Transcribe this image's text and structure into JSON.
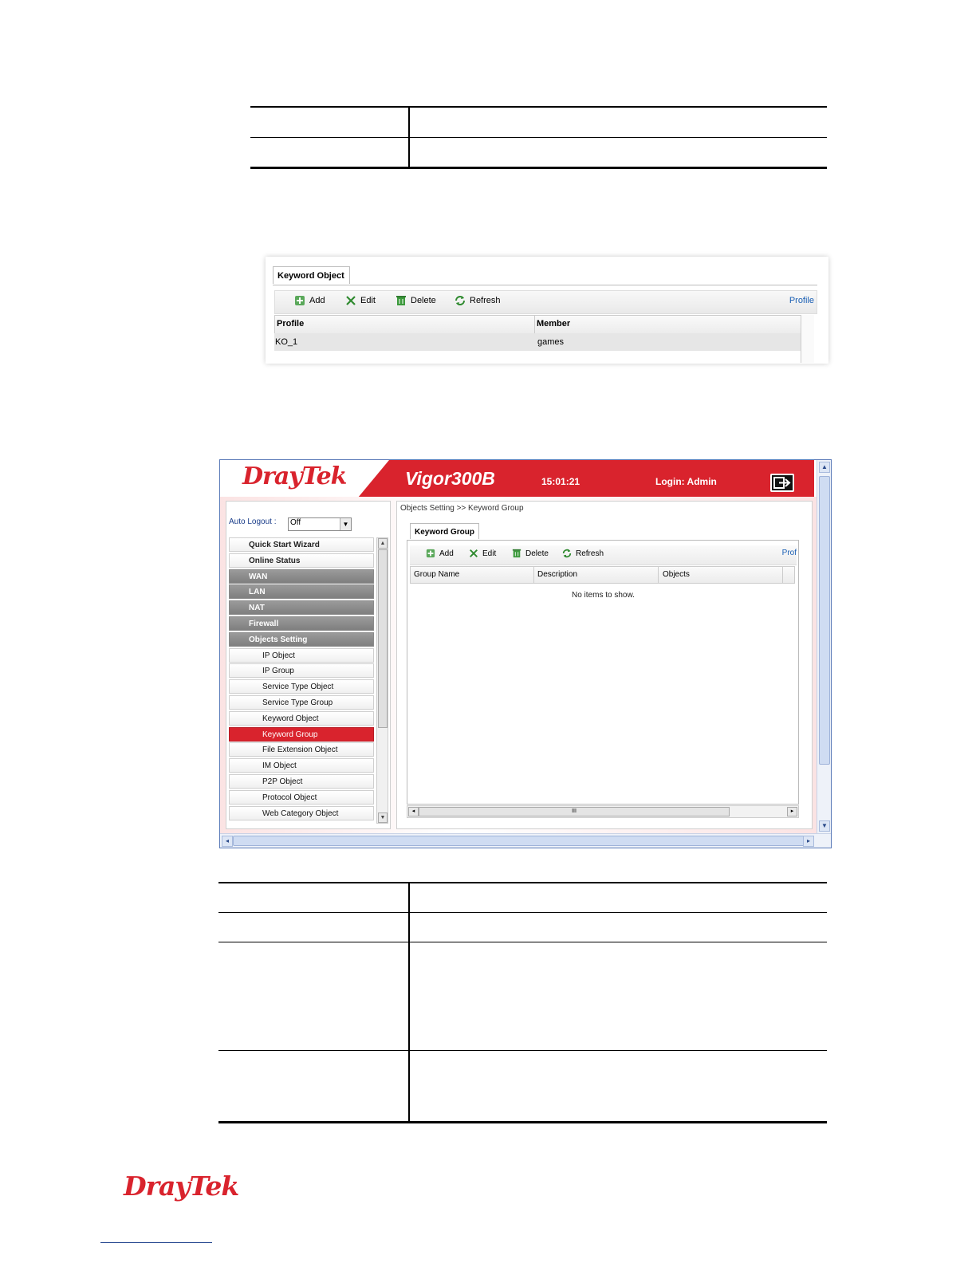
{
  "keyword_object": {
    "tab": "Keyword Object",
    "toolbar": {
      "add": "Add",
      "edit": "Edit",
      "delete": "Delete",
      "refresh": "Refresh",
      "profile_link": "Profile"
    },
    "columns": [
      "Profile",
      "Member"
    ],
    "rows": [
      {
        "profile": "KO_1",
        "member": "games"
      }
    ]
  },
  "router": {
    "brand": "DrayTek",
    "model": "Vigor300B",
    "time": "15:01:21",
    "login": "Login: Admin",
    "auto_logout_label": "Auto Logout :",
    "auto_logout_value": "Off",
    "menu": [
      {
        "label": "Quick Start Wizard",
        "kind": "top"
      },
      {
        "label": "Online Status",
        "kind": "top"
      },
      {
        "label": "WAN",
        "kind": "grp"
      },
      {
        "label": "LAN",
        "kind": "grp"
      },
      {
        "label": "NAT",
        "kind": "grp"
      },
      {
        "label": "Firewall",
        "kind": "grp"
      },
      {
        "label": "Objects Setting",
        "kind": "grp"
      },
      {
        "label": "IP Object",
        "kind": "sub"
      },
      {
        "label": "IP Group",
        "kind": "sub"
      },
      {
        "label": "Service Type Object",
        "kind": "sub"
      },
      {
        "label": "Service Type Group",
        "kind": "sub"
      },
      {
        "label": "Keyword Object",
        "kind": "sub"
      },
      {
        "label": "Keyword Group",
        "kind": "sub",
        "active": true
      },
      {
        "label": "File Extension Object",
        "kind": "sub"
      },
      {
        "label": "IM Object",
        "kind": "sub"
      },
      {
        "label": "P2P Object",
        "kind": "sub"
      },
      {
        "label": "Protocol Object",
        "kind": "sub"
      },
      {
        "label": "Web Category Object",
        "kind": "sub"
      }
    ],
    "breadcrumb": "Objects Setting >> Keyword Group",
    "tab": "Keyword Group",
    "toolbar": {
      "add": "Add",
      "edit": "Edit",
      "delete": "Delete",
      "refresh": "Refresh",
      "profile_link": "Prof"
    },
    "columns": [
      "Group Name",
      "Description",
      "Objects"
    ],
    "empty_text": "No items to show.",
    "scroll_thumb_glyph": "III"
  },
  "footer": {
    "logo": "DrayTek"
  },
  "colors": {
    "brand_red": "#d9232d",
    "link_blue": "#1a5fb4",
    "menu_gray": "#8a8a8a"
  }
}
